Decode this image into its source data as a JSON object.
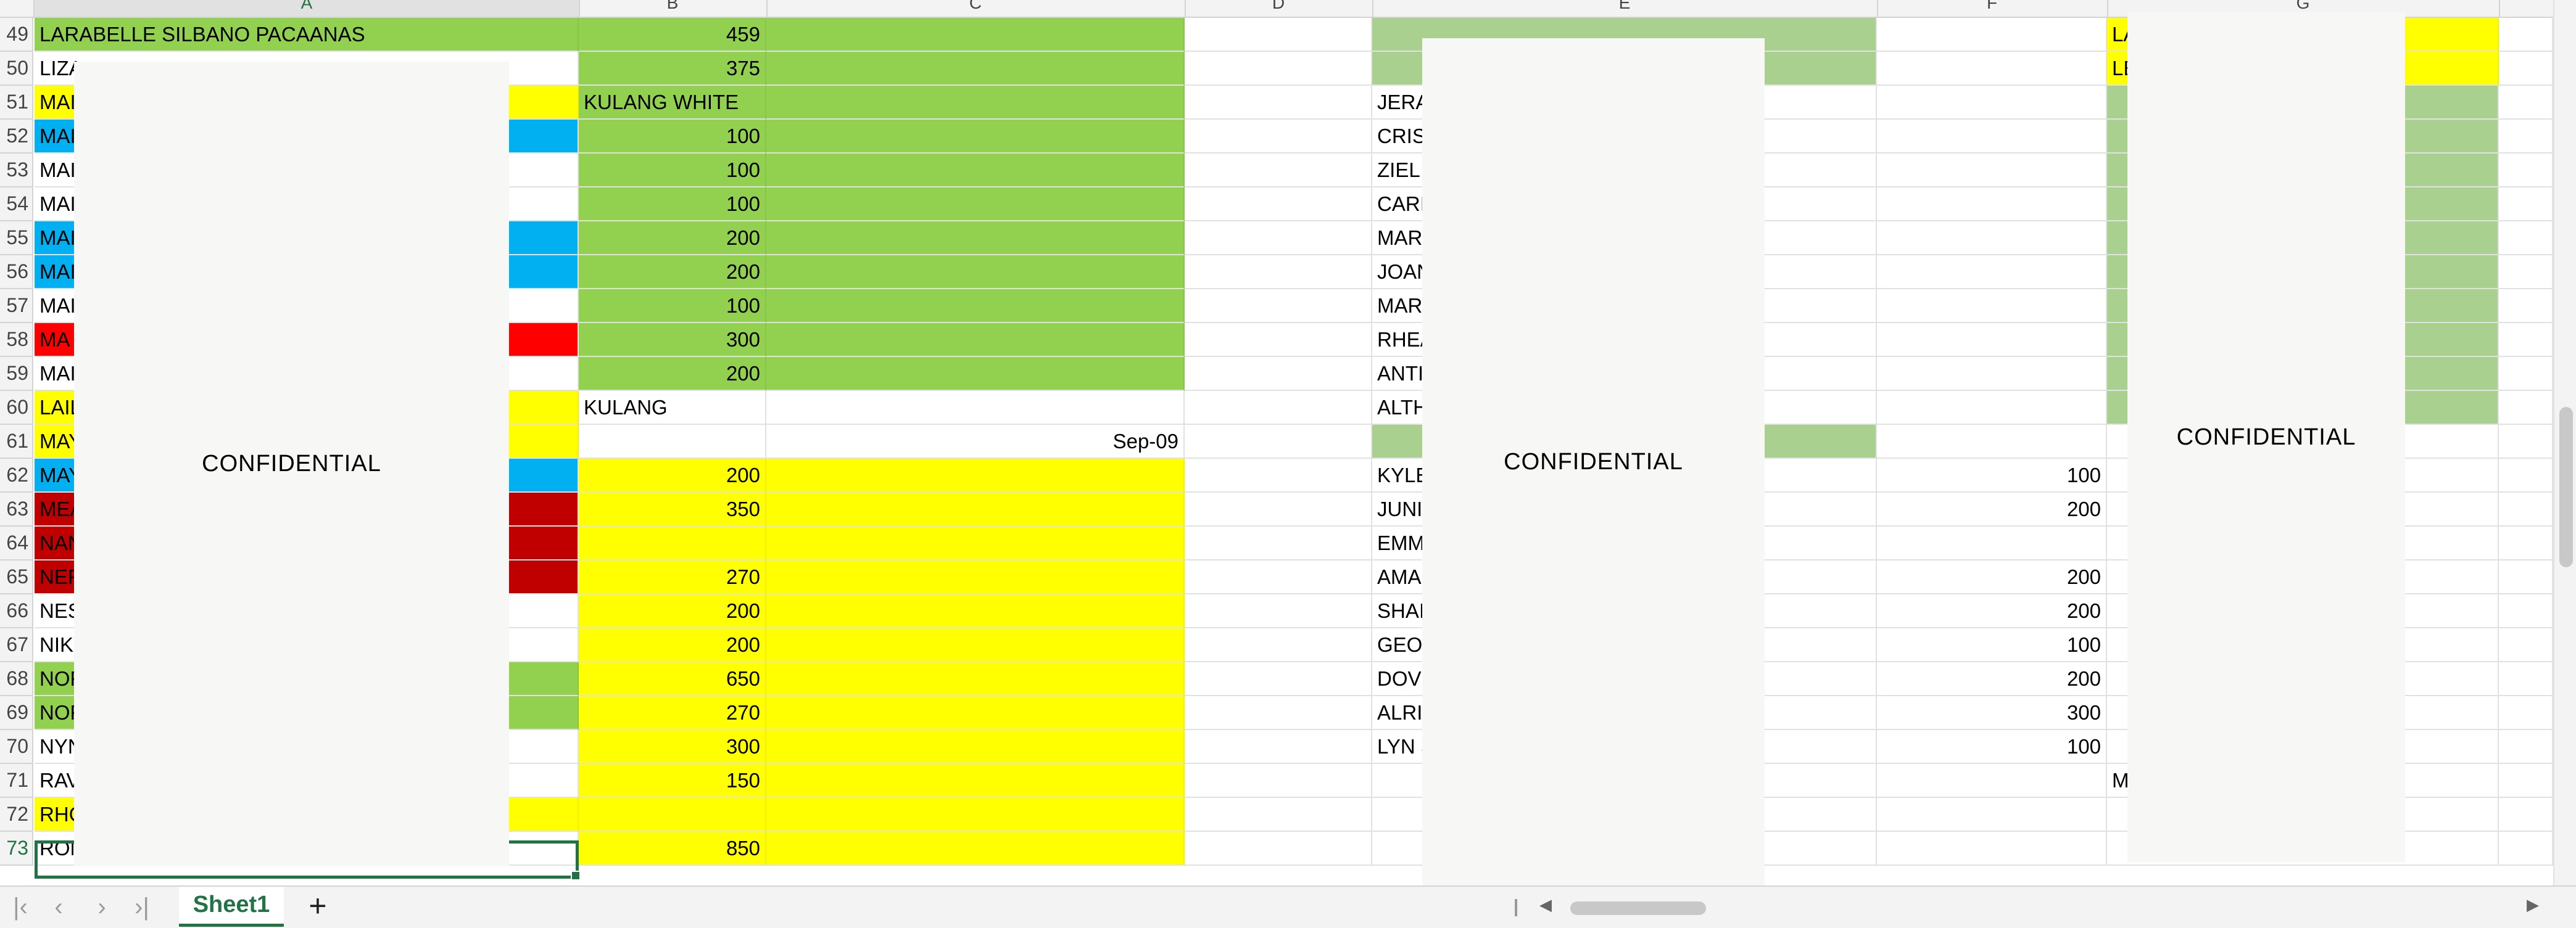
{
  "colors": {
    "green": "#92d050",
    "light_green": "#a9d08e",
    "yellow": "#ffff00",
    "blue": "#00b0f0",
    "red": "#ff0000",
    "dark_red": "#c00000",
    "mask": "#f7f7f5",
    "accent": "#217346"
  },
  "mask_text": "CONFIDENTIAL",
  "rows": [
    {
      "num": "49",
      "a": "LARABELLE SILBANO PACAANAS",
      "b": "459",
      "c": "",
      "e": "",
      "f": "",
      "g": "LA"
    },
    {
      "num": "50",
      "a": "LIZA",
      "b": "375",
      "c": "",
      "e": "",
      "f": "",
      "g": "LE"
    },
    {
      "num": "51",
      "a": "MAI",
      "b": "KULANG WHITE",
      "c": "",
      "e": "JERA",
      "f": "",
      "g": ""
    },
    {
      "num": "52",
      "a": "MAI",
      "b": "100",
      "c": "",
      "e": "CRIS",
      "f": "",
      "g": ""
    },
    {
      "num": "53",
      "a": "MAI",
      "b": "100",
      "c": "",
      "e": "ZIEL",
      "f": "",
      "g": ""
    },
    {
      "num": "54",
      "a": "MAI",
      "b": "100",
      "c": "",
      "e": "CARI",
      "f": "",
      "g": ""
    },
    {
      "num": "55",
      "a": "MAI",
      "b": "200",
      "c": "",
      "e": "MAR",
      "f": "",
      "g": ""
    },
    {
      "num": "56",
      "a": "MAI",
      "b": "200",
      "c": "",
      "e": "JOAN",
      "f": "",
      "g": ""
    },
    {
      "num": "57",
      "a": "MAI",
      "b": "100",
      "c": "",
      "e": "MAR",
      "f": "",
      "g": ""
    },
    {
      "num": "58",
      "a": "MA",
      "b": "300",
      "c": "",
      "e": "RHEA",
      "f": "",
      "g": ""
    },
    {
      "num": "59",
      "a": "MAI",
      "b": "200",
      "c": "",
      "e": "ANTI",
      "f": "",
      "g": ""
    },
    {
      "num": "60",
      "a": "LAIL",
      "b": "KULANG",
      "c": "",
      "e": "ALTH",
      "f": "",
      "g": ""
    },
    {
      "num": "61",
      "a": "MAY",
      "b": "",
      "c": "Sep-09",
      "e": "",
      "f": "",
      "g": ""
    },
    {
      "num": "62",
      "a": "MAY",
      "b": "200",
      "c": "",
      "e": "KYLE",
      "f": "100",
      "g": ""
    },
    {
      "num": "63",
      "a": "MEA",
      "b": "350",
      "c": "",
      "e": "JUNI",
      "f": "200",
      "g": ""
    },
    {
      "num": "64",
      "a": "NAN",
      "b": "",
      "c": "",
      "e": "EMM",
      "f": "",
      "g": ""
    },
    {
      "num": "65",
      "a": "NER",
      "b": "270",
      "c": "",
      "e": "AMA",
      "f": "200",
      "g": ""
    },
    {
      "num": "66",
      "a": "NES",
      "b": "200",
      "c": "",
      "e": "SHAI",
      "f": "200",
      "g": ""
    },
    {
      "num": "67",
      "a": "NIK",
      "b": "200",
      "c": "",
      "e": "GEO",
      "f": "100",
      "g": ""
    },
    {
      "num": "68",
      "a": "NOF",
      "b": "650",
      "c": "",
      "e": "DOV",
      "f": "200",
      "g": ""
    },
    {
      "num": "69",
      "a": "NOF",
      "b": "270",
      "c": "",
      "e": "ALRI",
      "f": "300",
      "g": ""
    },
    {
      "num": "70",
      "a": "NYN",
      "b": "300",
      "c": "",
      "e": "LYN S",
      "f": "100",
      "g": ""
    },
    {
      "num": "71",
      "a": "RAV",
      "b": "150",
      "c": "",
      "e": "",
      "f": "",
      "g": "M"
    },
    {
      "num": "72",
      "a": "RHC",
      "b": "",
      "c": "",
      "e": "",
      "f": "",
      "g": ""
    },
    {
      "num": "73",
      "a": "RONA MIRA LUCANAS",
      "b": "850",
      "c": "",
      "e": "",
      "f": "",
      "g": ""
    }
  ],
  "columns": [
    "A",
    "B",
    "C",
    "D",
    "E",
    "F",
    "G"
  ],
  "sheet_tab": "Sheet1",
  "add_sheet": "+"
}
